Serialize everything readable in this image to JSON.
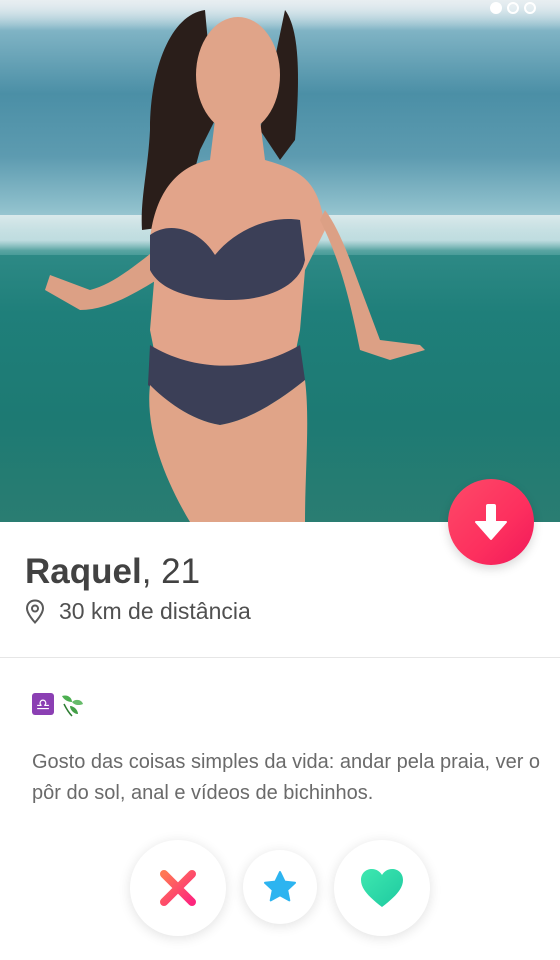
{
  "profile": {
    "name": "Raquel",
    "age_text": ", 21",
    "distance": "30 km de distância",
    "bio": "Gosto das coisas simples da vida: andar pela praia, ver o pôr do sol, anal e vídeos de bichinhos."
  },
  "photo": {
    "count": 3,
    "active_index": 0
  },
  "icons": {
    "info_button": "arrow-down-icon",
    "distance": "location-pin-icon",
    "emoji_1": "libra-zodiac-icon",
    "emoji_2": "herb-icon",
    "nope": "close-x-icon",
    "super_like": "star-icon",
    "like": "heart-icon"
  },
  "colors": {
    "info_button": "#fd3a62",
    "nope": "#fd5068",
    "super_like": "#2db4f0",
    "like": "#24d9a6",
    "text_primary": "#424242",
    "text_secondary": "#6a6a6a",
    "libra_bg": "#8b3fb3"
  }
}
